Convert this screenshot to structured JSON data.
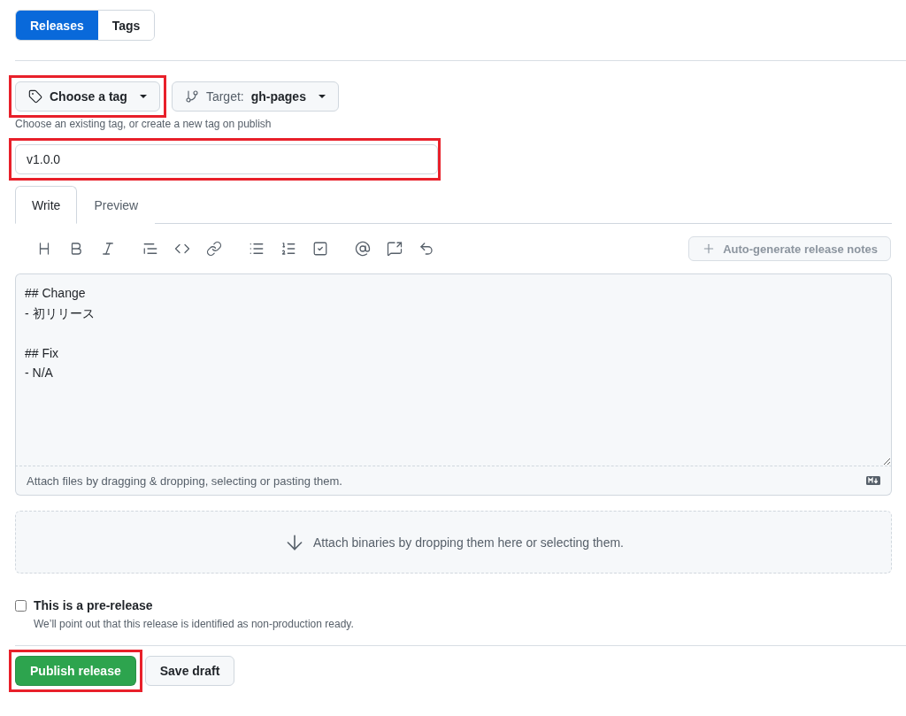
{
  "view_toggle": [
    {
      "label": "Releases",
      "selected": true
    },
    {
      "label": "Tags",
      "selected": false
    }
  ],
  "tag_picker": {
    "label": "Choose a tag",
    "highlighted": true
  },
  "target_picker": {
    "prefix": "Target:",
    "branch": "gh-pages"
  },
  "tag_hint": "Choose an existing tag, or create a new tag on publish",
  "title_field": {
    "value": "v1.0.0",
    "highlighted": true
  },
  "editor_tabs": [
    {
      "label": "Write",
      "selected": true
    },
    {
      "label": "Preview",
      "selected": false
    }
  ],
  "auto_generate_button": "Auto-generate release notes",
  "editor": {
    "value": "## Change\n- 初リリース\n\n## Fix\n- N/A",
    "footer": "Attach files by dragging & dropping, selecting or pasting them."
  },
  "binaries_dropzone": "Attach binaries by dropping them here or selecting them.",
  "prerelease": {
    "label": "This is a pre-release",
    "note": "We’ll point out that this release is identified as non-production ready.",
    "checked": false
  },
  "actions": [
    {
      "label": "Publish release",
      "kind": "primary",
      "highlighted": true
    },
    {
      "label": "Save draft",
      "kind": "secondary",
      "highlighted": false
    }
  ]
}
